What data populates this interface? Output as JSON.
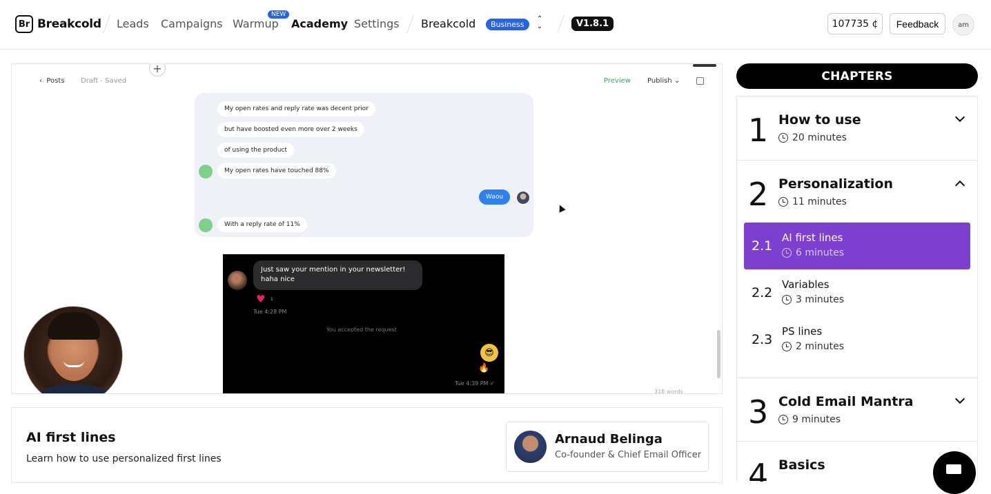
{
  "nav": {
    "logo_mark": "Br",
    "logo_text": "Breakcold",
    "links": [
      "Leads",
      "Campaigns",
      "Warmup",
      "Academy",
      "Settings"
    ],
    "new_badge": "NEW",
    "workspace": "Breakcold",
    "plan_badge": "Business",
    "version": "V1.8.1",
    "credits": "107735 ¢",
    "feedback": "Feedback",
    "avatar_initials": "am"
  },
  "video": {
    "posts_link": "Posts",
    "draft_status": "Draft - Saved",
    "preview": "Preview",
    "publish": "Publish",
    "chat_messages": [
      "My open rates and reply rate was decent prior",
      "but have boosted even more over 2 weeks",
      "of using the product",
      "My open rates have touched 88%",
      "Waou",
      "With a reply rate of 11%"
    ],
    "dm_message_line1": "Just saw your mention in your newsletter!",
    "dm_message_line2": "haha nice",
    "heart_count": "1",
    "dm_time1": "Tue 4:28 PM",
    "dm_accepted": "You accepted the request",
    "dm_time2": "Tue 4:39 PM ✓",
    "word_count": "318 words"
  },
  "lesson": {
    "title": "AI first lines",
    "description": "Learn how to use personalized first lines",
    "author_name": "Arnaud Belinga",
    "author_role": "Co-founder & Chief Email Officer"
  },
  "chapters": {
    "header": "CHAPTERS",
    "items": [
      {
        "num": "1",
        "title": "How to use",
        "time": "20 minutes"
      },
      {
        "num": "2",
        "title": "Personalization",
        "time": "11 minutes"
      },
      {
        "num": "3",
        "title": "Cold Email Mantra",
        "time": "9 minutes"
      },
      {
        "num": "4",
        "title": "Basics",
        "time": ""
      }
    ],
    "sub_items": [
      {
        "num": "2.1",
        "title": "AI first lines",
        "time": "6 minutes"
      },
      {
        "num": "2.2",
        "title": "Variables",
        "time": "3 minutes"
      },
      {
        "num": "2.3",
        "title": "PS lines",
        "time": "2 minutes"
      }
    ]
  },
  "colors": {
    "accent_purple": "#7c3fd0",
    "badge_blue": "#2563eb"
  }
}
